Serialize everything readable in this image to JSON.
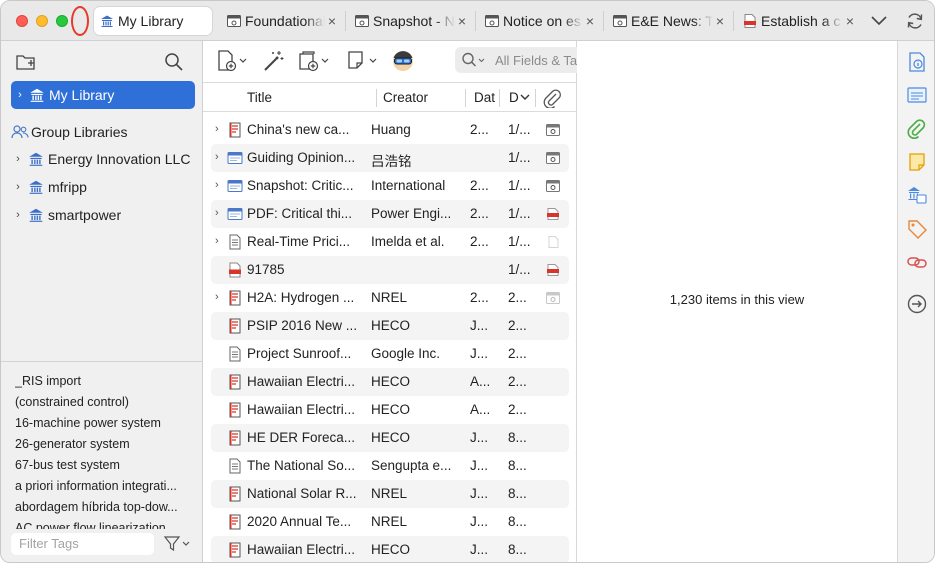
{
  "tabs": [
    {
      "label": "My Library",
      "icon": "library-icon",
      "active": true
    },
    {
      "label": "Foundational",
      "icon": "webpage-icon"
    },
    {
      "label": "Snapshot - N",
      "icon": "webpage-icon"
    },
    {
      "label": "Notice on es",
      "icon": "webpage-icon"
    },
    {
      "label": "E&E News: T",
      "icon": "webpage-icon"
    },
    {
      "label": "Establish a c",
      "icon": "pdf-icon"
    }
  ],
  "tab_close_glyph": "×",
  "sidebar": {
    "my_library": "My Library",
    "group_libraries_label": "Group Libraries",
    "groups": [
      {
        "label": "Energy Innovation LLC"
      },
      {
        "label": "mfripp"
      },
      {
        "label": "smartpower"
      }
    ]
  },
  "tags": [
    "_RIS import",
    "(constrained control)",
    "16-machine power system",
    "26-generator system",
    "67-bus test system",
    "a priori information integrati...",
    "abordagem híbrida top-dow...",
    "AC power flow linearization"
  ],
  "tag_filter_placeholder": "Filter Tags",
  "search_placeholder": "All Fields & Tags",
  "columns": {
    "title": "Title",
    "creator": "Creator",
    "date": "Dat",
    "date_modified": "D"
  },
  "items": [
    {
      "expand": true,
      "icon": "report-icon",
      "title": "China's new ca...",
      "creator": "Huang",
      "date": "2...",
      "modified": "1/...",
      "attachment": "snapshot"
    },
    {
      "expand": true,
      "icon": "webpage-icon",
      "title": "Guiding Opinion...",
      "creator": "吕浩铭",
      "date": "",
      "modified": "1/...",
      "attachment": "snapshot"
    },
    {
      "expand": true,
      "icon": "webpage-icon",
      "title": "Snapshot: Critic...",
      "creator": "International",
      "date": "2...",
      "modified": "1/...",
      "attachment": "snapshot"
    },
    {
      "expand": true,
      "icon": "webpage-icon",
      "title": "PDF: Critical thi...",
      "creator": "Power Engi...",
      "date": "2...",
      "modified": "1/...",
      "attachment": "pdf"
    },
    {
      "expand": true,
      "icon": "document-icon",
      "title": "Real-Time Prici...",
      "creator": "Imelda et al.",
      "date": "2...",
      "modified": "1/...",
      "attachment": "file"
    },
    {
      "expand": false,
      "icon": "pdf-icon",
      "title": "91785",
      "creator": "",
      "date": "",
      "modified": "1/...",
      "attachment": "pdf"
    },
    {
      "expand": true,
      "icon": "report-icon",
      "title": "H2A: Hydrogen ...",
      "creator": "NREL",
      "date": "2...",
      "modified": "2...",
      "attachment": "snapshot-faded"
    },
    {
      "expand": false,
      "icon": "report-icon",
      "title": "PSIP 2016 New ...",
      "creator": "HECO",
      "date": "J...",
      "modified": "2...",
      "attachment": ""
    },
    {
      "expand": false,
      "icon": "document-icon",
      "title": "Project Sunroof...",
      "creator": "Google Inc.",
      "date": "J...",
      "modified": "2...",
      "attachment": ""
    },
    {
      "expand": false,
      "icon": "report-icon",
      "title": "Hawaiian Electri...",
      "creator": "HECO",
      "date": "A...",
      "modified": "2...",
      "attachment": ""
    },
    {
      "expand": false,
      "icon": "report-icon",
      "title": "Hawaiian Electri...",
      "creator": "HECO",
      "date": "A...",
      "modified": "2...",
      "attachment": ""
    },
    {
      "expand": false,
      "icon": "report-icon",
      "title": "HE DER Foreca...",
      "creator": "HECO",
      "date": "J...",
      "modified": "8...",
      "attachment": ""
    },
    {
      "expand": false,
      "icon": "document-icon",
      "title": "The National So...",
      "creator": "Sengupta e...",
      "date": "J...",
      "modified": "8...",
      "attachment": ""
    },
    {
      "expand": false,
      "icon": "report-icon",
      "title": "National Solar R...",
      "creator": "NREL",
      "date": "J...",
      "modified": "8...",
      "attachment": ""
    },
    {
      "expand": false,
      "icon": "report-icon",
      "title": "2020 Annual Te...",
      "creator": "NREL",
      "date": "J...",
      "modified": "8...",
      "attachment": ""
    },
    {
      "expand": false,
      "icon": "report-icon",
      "title": "Hawaiian Electri...",
      "creator": "HECO",
      "date": "J...",
      "modified": "8...",
      "attachment": ""
    }
  ],
  "item_count_text": "1,230 items in this view",
  "colors": {
    "accent": "#2f6fd8",
    "pdf_red": "#d9342b",
    "webpage_blue": "#4a78c8"
  }
}
